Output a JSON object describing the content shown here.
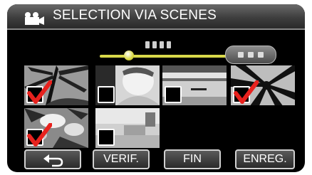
{
  "header": {
    "title": "SELECTION VIA SCENES",
    "icon": "movie-camera-icon"
  },
  "timeline": {
    "position": 0.12
  },
  "thumbnails": [
    {
      "scene": "palm-leaves",
      "checked": true
    },
    {
      "scene": "person-portrait",
      "checked": false
    },
    {
      "scene": "lake-boat",
      "checked": false
    },
    {
      "scene": "palm-silhouette",
      "checked": true
    },
    {
      "scene": "flowers",
      "checked": true
    },
    {
      "scene": "room-interior",
      "checked": false
    }
  ],
  "buttons": {
    "back_icon": "return-arrow-icon",
    "verif_label": "VERIF.",
    "fin_label": "FIN",
    "enreg_label": "ENREG."
  },
  "colors": {
    "check_red": "#e8221e",
    "slider_yellow": "#d8d84a"
  }
}
